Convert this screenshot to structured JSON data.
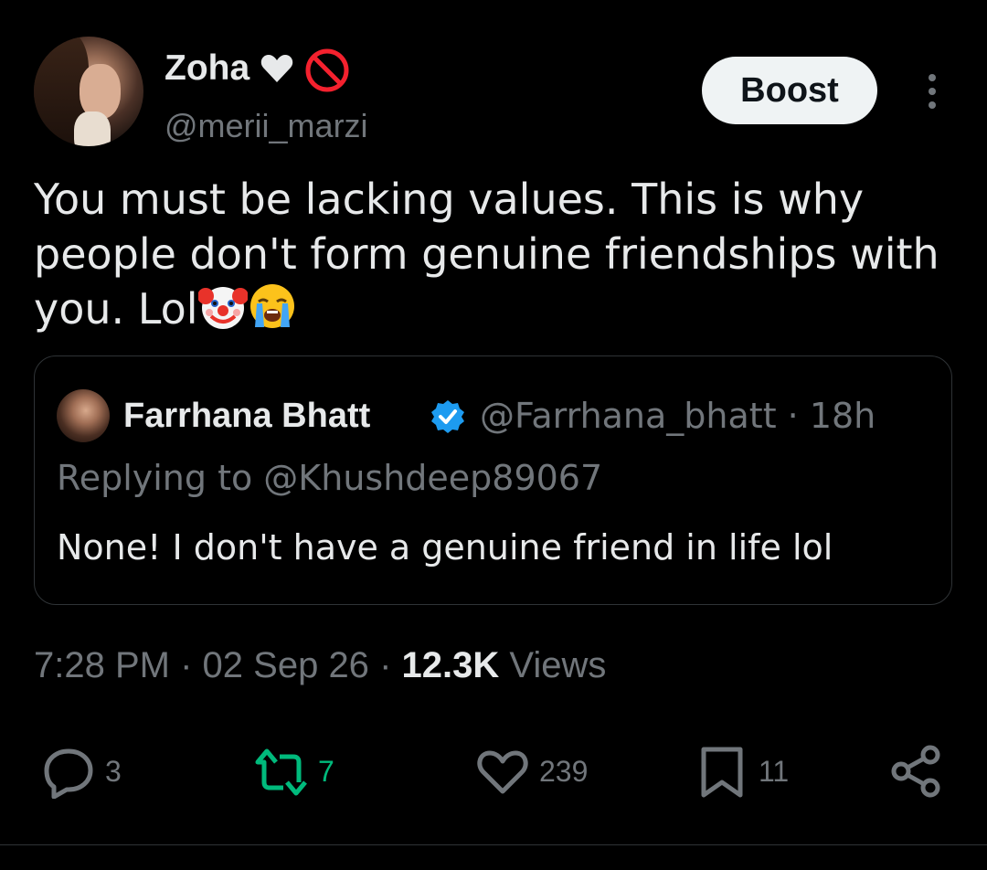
{
  "author": {
    "display_name": "Zoha",
    "handle": "@merii_marzi",
    "boost_label": "Boost"
  },
  "tweet": {
    "text": "You must be lacking values. This is why people don't form genuine friendships with you. Lol"
  },
  "quoted": {
    "name": "Farrhana Bhatt",
    "handle_time": "@Farrhana_bhatt · 18h",
    "replying_to": "Replying to @Khushdeep89067",
    "text": "None! I don't have a genuine friend in life lol"
  },
  "meta": {
    "time": "7:28 PM",
    "date": "02 Sep 26",
    "views_count": "12.3K",
    "views_label": "Views"
  },
  "actions": {
    "replies": "3",
    "retweets": "7",
    "likes": "239",
    "bookmarks": "11"
  },
  "colors": {
    "background": "#000000",
    "text": "#e7e9ea",
    "muted": "#71767b",
    "retweet_green": "#00ba7c",
    "verified_blue": "#1d9bf0",
    "block_red": "#f4212e"
  }
}
